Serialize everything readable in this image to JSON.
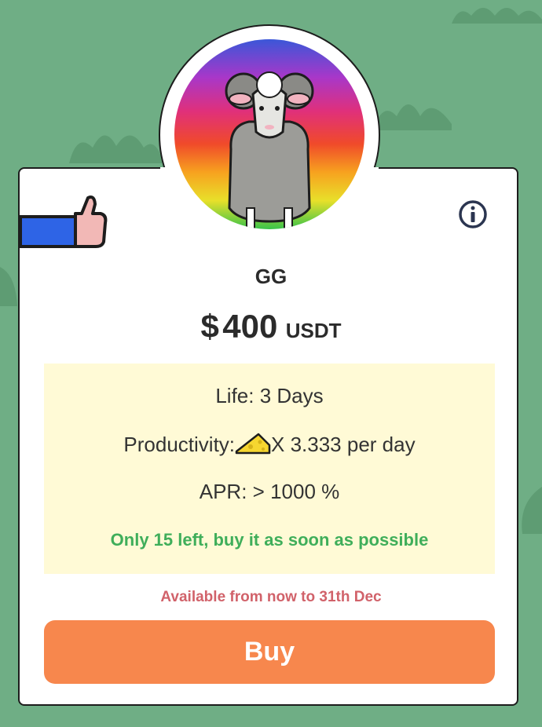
{
  "colors": {
    "background": "#6fae85",
    "accent": "#f7874d",
    "panel": "#fffad6",
    "stock_text": "#3fae5a",
    "availability_text": "#d1626a"
  },
  "icons": {
    "like": "thumbs-up-icon",
    "info": "info-icon",
    "cheese": "cheese-icon",
    "avatar": "sheep-avatar"
  },
  "product": {
    "name": "GG",
    "price_symbol": "$",
    "price_value": "400",
    "currency": "USDT"
  },
  "details": {
    "life": "Life: 3 Days",
    "productivity_prefix": "Productivity:",
    "productivity_suffix": "X 3.333 per day",
    "apr": "APR: > 1000 %",
    "stock_notice": "Only 15 left, buy it as soon as possible"
  },
  "availability": "Available from now to 31th Dec",
  "buy_label": "Buy"
}
